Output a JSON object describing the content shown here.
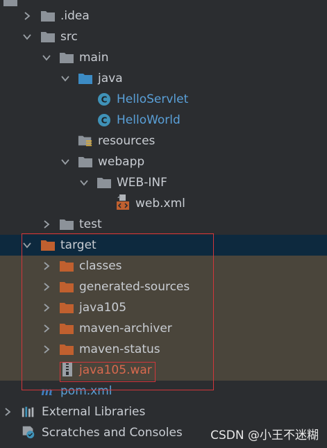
{
  "tree": {
    "items": [
      {
        "label": "",
        "icon": "folder-icon"
      },
      {
        "label": ".idea",
        "icon": "folder-icon"
      },
      {
        "label": "src",
        "icon": "folder-icon"
      },
      {
        "label": "main",
        "icon": "folder-icon"
      },
      {
        "label": "java",
        "icon": "source-folder-icon"
      },
      {
        "label": "HelloServlet",
        "icon": "java-class-icon"
      },
      {
        "label": "HelloWorld",
        "icon": "java-class-icon"
      },
      {
        "label": "resources",
        "icon": "resources-folder-icon"
      },
      {
        "label": "webapp",
        "icon": "folder-icon"
      },
      {
        "label": "WEB-INF",
        "icon": "folder-icon"
      },
      {
        "label": "web.xml",
        "icon": "xml-file-icon"
      },
      {
        "label": "test",
        "icon": "folder-icon"
      },
      {
        "label": "target",
        "icon": "excluded-folder-icon"
      },
      {
        "label": "classes",
        "icon": "excluded-folder-icon"
      },
      {
        "label": "generated-sources",
        "icon": "excluded-folder-icon"
      },
      {
        "label": "java105",
        "icon": "excluded-folder-icon"
      },
      {
        "label": "maven-archiver",
        "icon": "excluded-folder-icon"
      },
      {
        "label": "maven-status",
        "icon": "excluded-folder-icon"
      },
      {
        "label": "java105.war",
        "icon": "archive-icon"
      },
      {
        "label": "pom.xml",
        "icon": "maven-icon"
      },
      {
        "label": "External Libraries",
        "icon": "libraries-icon"
      },
      {
        "label": "Scratches and Consoles",
        "icon": "scratches-icon"
      }
    ]
  },
  "watermark": "CSDN @小王不迷糊",
  "colors": {
    "background": "#2b2d30",
    "selected_row": "#0d293e",
    "tinted_row": "#4a453b",
    "folder_gray": "#8c9299",
    "folder_blue": "#3c8bc4",
    "folder_orange": "#c0602f",
    "text": "#c9cdd3",
    "blue_text": "#5aa0d8",
    "red_text": "#d8694e",
    "highlight_box": "#d2363b"
  }
}
